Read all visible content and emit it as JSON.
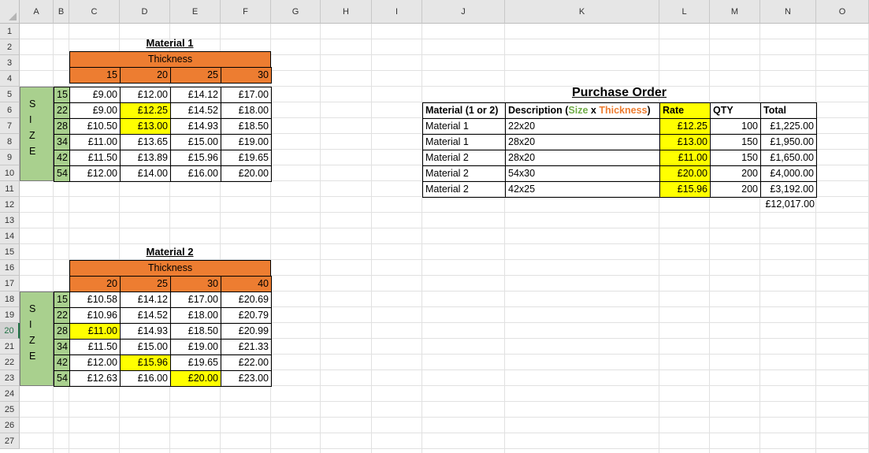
{
  "sheet": {
    "columns": [
      "A",
      "B",
      "C",
      "D",
      "E",
      "F",
      "G",
      "H",
      "I",
      "J",
      "K",
      "L",
      "M",
      "N",
      "O"
    ],
    "rows": [
      "1",
      "2",
      "3",
      "4",
      "5",
      "6",
      "7",
      "8",
      "9",
      "10",
      "11",
      "12",
      "13",
      "14",
      "15",
      "16",
      "17",
      "18",
      "19",
      "20",
      "21",
      "22",
      "23",
      "24",
      "25",
      "26",
      "27"
    ],
    "selected_row": "20"
  },
  "colors": {
    "header": "#ed7d31",
    "highlight": "#ffff00",
    "size_fill": "#a9d08e",
    "accent": "#217346"
  },
  "material1": {
    "title": "Material 1",
    "thickness_label": "Thickness",
    "size_letters": [
      "S",
      "I",
      "Z",
      "E"
    ],
    "thicknesses": [
      "15",
      "20",
      "25",
      "30"
    ],
    "sizes": [
      "15",
      "22",
      "28",
      "34",
      "42",
      "54"
    ],
    "values": [
      [
        "£9.00",
        "£12.00",
        "£14.12",
        "£17.00"
      ],
      [
        "£9.00",
        "£12.25",
        "£14.52",
        "£18.00"
      ],
      [
        "£10.50",
        "£13.00",
        "£14.93",
        "£18.50"
      ],
      [
        "£11.00",
        "£13.65",
        "£15.00",
        "£19.00"
      ],
      [
        "£11.50",
        "£13.89",
        "£15.96",
        "£19.65"
      ],
      [
        "£12.00",
        "£14.00",
        "£16.00",
        "£20.00"
      ]
    ]
  },
  "material2": {
    "title": "Material 2",
    "thickness_label": "Thickness",
    "size_letters": [
      "S",
      "I",
      "Z",
      "E"
    ],
    "thicknesses": [
      "20",
      "25",
      "30",
      "40"
    ],
    "sizes": [
      "15",
      "22",
      "28",
      "34",
      "42",
      "54"
    ],
    "values": [
      [
        "£10.58",
        "£14.12",
        "£17.00",
        "£20.69"
      ],
      [
        "£10.96",
        "£14.52",
        "£18.00",
        "£20.79"
      ],
      [
        "£11.00",
        "£14.93",
        "£18.50",
        "£20.99"
      ],
      [
        "£11.50",
        "£15.00",
        "£19.00",
        "£21.33"
      ],
      [
        "£12.00",
        "£15.96",
        "£19.65",
        "£22.00"
      ],
      [
        "£12.63",
        "£16.00",
        "£20.00",
        "£23.00"
      ]
    ]
  },
  "purchase_order": {
    "title": "Purchase Order",
    "headers": {
      "material": "Material (1 or 2)",
      "desc_prefix": "Description (",
      "desc_size": "Size",
      "desc_x": " x ",
      "desc_thick": "Thickness",
      "desc_suffix": ")",
      "rate": "Rate",
      "qty": "QTY",
      "total": "Total"
    },
    "rows": [
      {
        "material": "Material 1",
        "desc": "22x20",
        "rate": "£12.25",
        "qty": "100",
        "total": "£1,225.00"
      },
      {
        "material": "Material 1",
        "desc": "28x20",
        "rate": "£13.00",
        "qty": "150",
        "total": "£1,950.00"
      },
      {
        "material": "Material 2",
        "desc": "28x20",
        "rate": "£11.00",
        "qty": "150",
        "total": "£1,650.00"
      },
      {
        "material": "Material 2",
        "desc": "54x30",
        "rate": "£20.00",
        "qty": "200",
        "total": "£4,000.00"
      },
      {
        "material": "Material 2",
        "desc": "42x25",
        "rate": "£15.96",
        "qty": "200",
        "total": "£3,192.00"
      }
    ],
    "grand_total": "£12,017.00"
  }
}
